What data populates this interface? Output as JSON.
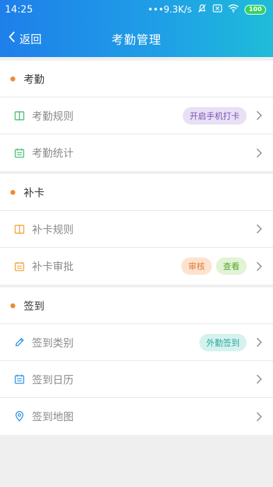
{
  "status": {
    "time": "14:25",
    "speed": "•••9.3K/s",
    "battery": "100"
  },
  "nav": {
    "back_label": "返回",
    "title": "考勤管理"
  },
  "sections": [
    {
      "title": "考勤",
      "items": [
        {
          "label": "考勤规则",
          "badges": [
            "开启手机打卡"
          ]
        },
        {
          "label": "考勤统计",
          "badges": []
        }
      ]
    },
    {
      "title": "补卡",
      "items": [
        {
          "label": "补卡规则",
          "badges": []
        },
        {
          "label": "补卡审批",
          "badges": [
            "审核",
            "查看"
          ]
        }
      ]
    },
    {
      "title": "签到",
      "items": [
        {
          "label": "签到类别",
          "badges": [
            "外勤签到"
          ]
        },
        {
          "label": "签到日历",
          "badges": []
        },
        {
          "label": "签到地图",
          "badges": []
        }
      ]
    }
  ],
  "colors": {
    "accent_dot": "#f08a33",
    "icon_green": "#3dbb6a",
    "icon_orange": "#f0a030",
    "icon_blue": "#2a8ee0",
    "badge_purple_bg": "#e8e0f5",
    "badge_purple_fg": "#7a52b8",
    "badge_orange_bg": "#fde3cf",
    "badge_orange_fg": "#e07830",
    "badge_green_bg": "#e2f3d6",
    "badge_green_fg": "#5aa62f",
    "badge_teal_bg": "#d5f2ee",
    "badge_teal_fg": "#2aa898"
  },
  "icons": {
    "section_1": [
      "book-icon",
      "calendar-icon"
    ],
    "section_2": [
      "book-icon",
      "calendar-icon"
    ],
    "section_3": [
      "pencil-icon",
      "calendar-icon",
      "location-pin-icon"
    ]
  }
}
